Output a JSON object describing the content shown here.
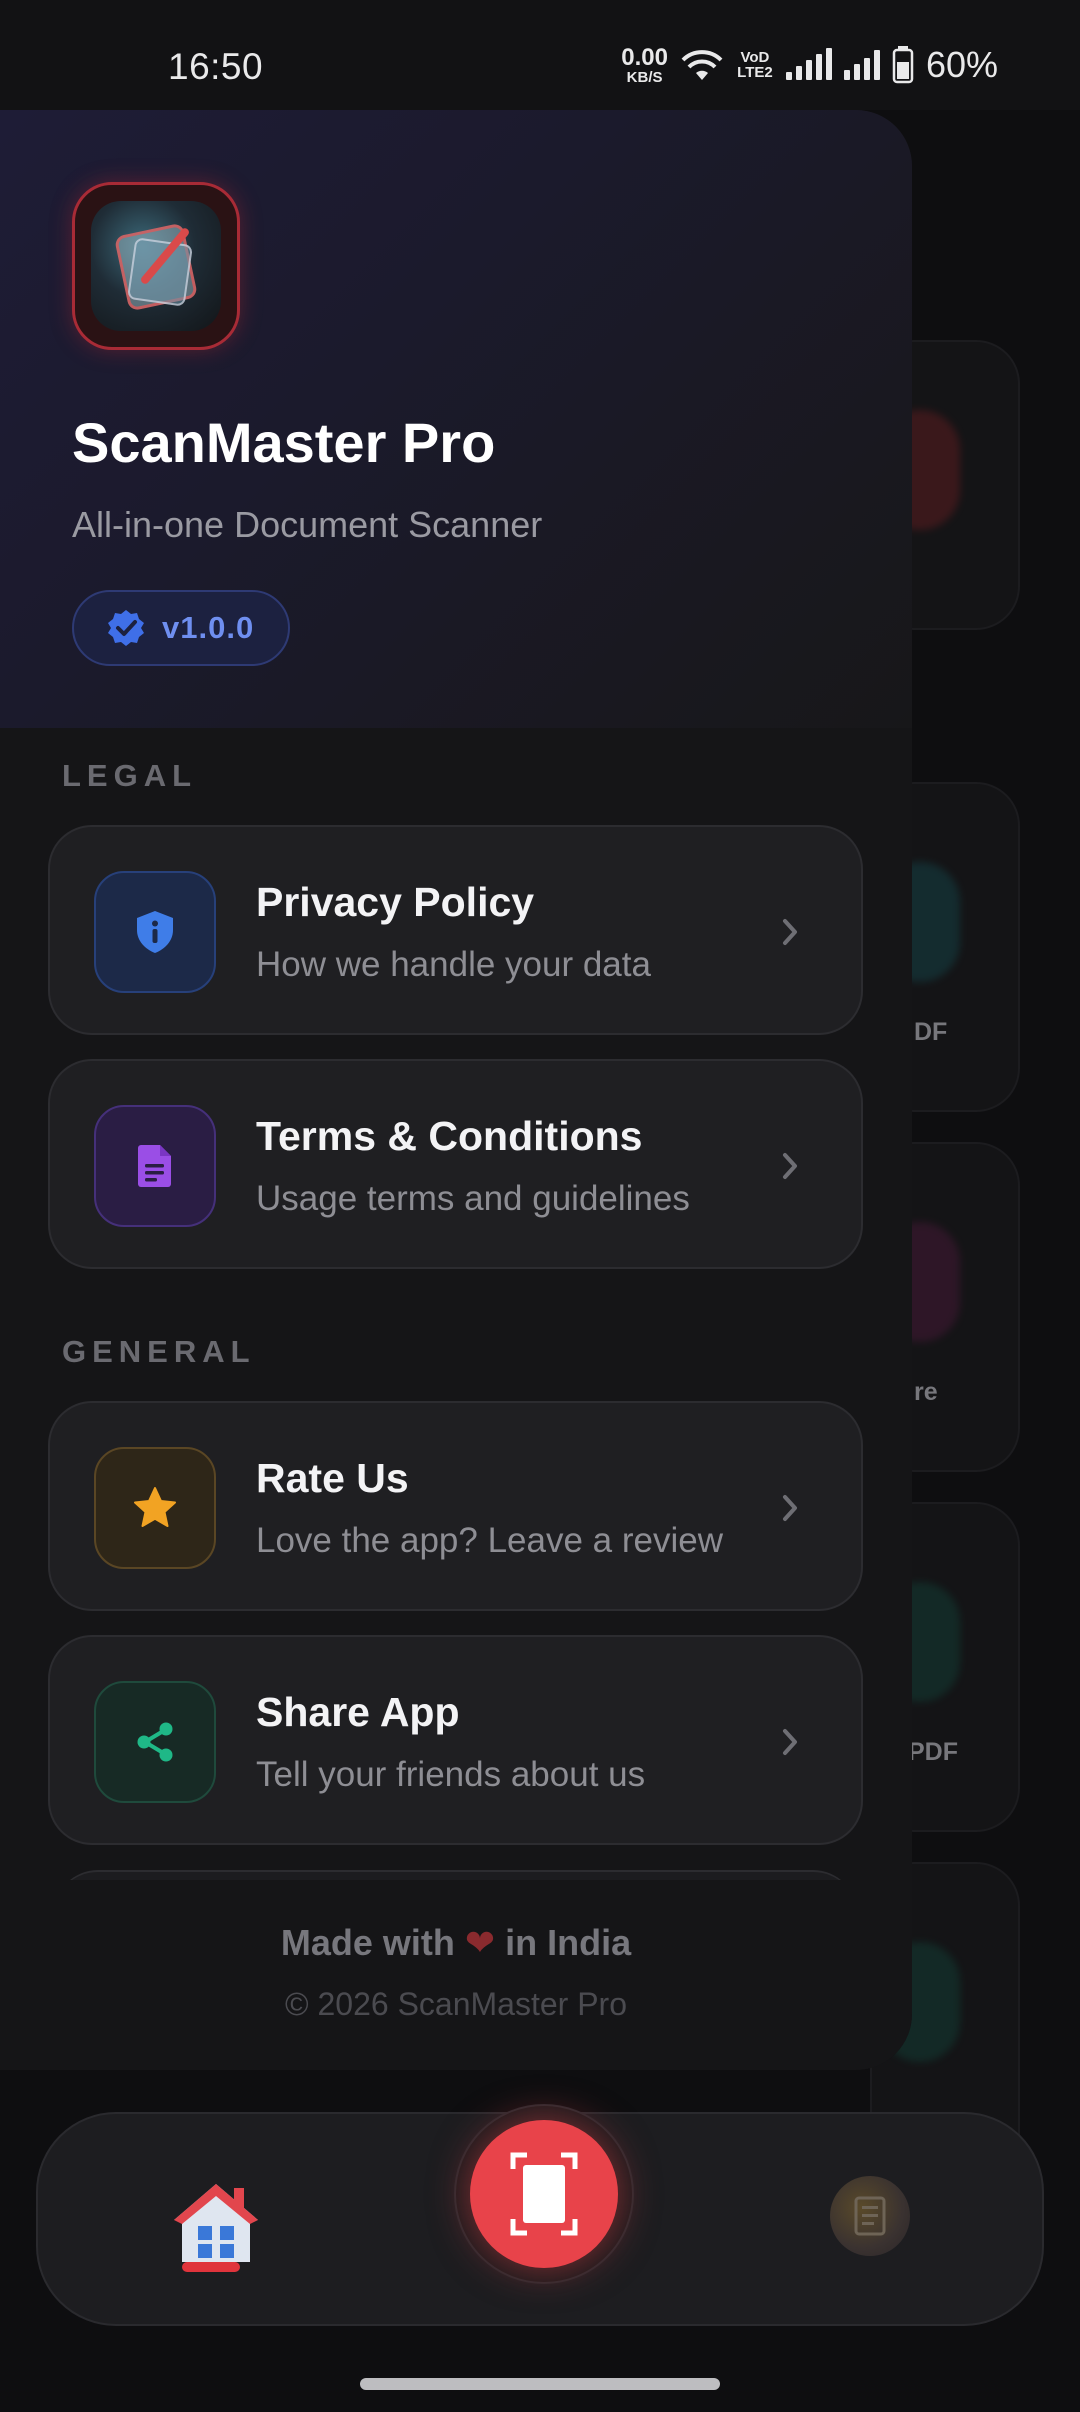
{
  "status_bar": {
    "time": "16:50",
    "net_speed_value": "0.00",
    "net_speed_unit": "KB/S",
    "volte_label": "VoD LTE2",
    "battery": "60%"
  },
  "drawer": {
    "app_title": "ScanMaster Pro",
    "app_subtitle": "All-in-one Document Scanner",
    "version": "v1.0.0",
    "sections": [
      {
        "label": "LEGAL",
        "items": [
          {
            "title": "Privacy Policy",
            "description": "How we handle your data",
            "icon": "shield-info-icon",
            "accent": "#3f7de8"
          },
          {
            "title": "Terms & Conditions",
            "description": "Usage terms and guidelines",
            "icon": "document-icon",
            "accent": "#9a4ee6"
          }
        ]
      },
      {
        "label": "GENERAL",
        "items": [
          {
            "title": "Rate Us",
            "description": "Love the app? Leave a review",
            "icon": "star-icon",
            "accent": "#f2a323"
          },
          {
            "title": "Share App",
            "description": "Tell your friends about us",
            "icon": "share-icon",
            "accent": "#1fb887"
          }
        ]
      }
    ],
    "footer": {
      "made_with_prefix": "Made with",
      "made_with_suffix": "in India",
      "heart": "❤",
      "copyright": "© 2026 ScanMaster Pro"
    }
  },
  "background_screen": {
    "card_labels": [
      "DF",
      "re",
      "PDF"
    ]
  },
  "bottom_nav": {
    "items": [
      "home-icon",
      "scan-icon",
      "documents-icon"
    ],
    "accent": "#e8434a"
  }
}
